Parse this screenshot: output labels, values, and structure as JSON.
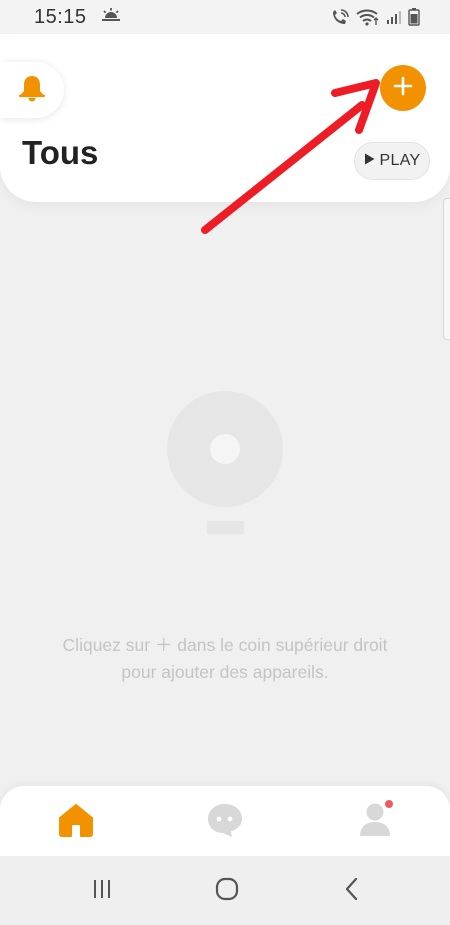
{
  "status_bar": {
    "time": "15:15",
    "icons": [
      "weather-sunrise-icon",
      "wifi-call-icon",
      "wifi-icon",
      "signal-icon",
      "battery-icon"
    ]
  },
  "header": {
    "title": "Tous",
    "play_label": "PLAY",
    "icons": [
      "bell-icon",
      "plus-icon",
      "play-icon"
    ]
  },
  "empty_state": {
    "line1": "Cliquez sur ＋ dans le coin supérieur droit",
    "line2": "pour ajouter des appareils."
  },
  "bottom_nav": {
    "items": [
      {
        "name": "home",
        "icon": "home-icon",
        "active": true
      },
      {
        "name": "chat",
        "icon": "chat-icon",
        "active": false
      },
      {
        "name": "profile",
        "icon": "profile-icon",
        "active": false,
        "notification": true
      }
    ]
  },
  "system_nav": {
    "icons": [
      "recents-icon",
      "home-circle-icon",
      "back-icon"
    ]
  },
  "colors": {
    "accent": "#f39200",
    "annotation_arrow": "#ee1c25",
    "notification": "#f05a5a",
    "inactive_icon": "#d8d8d8"
  }
}
